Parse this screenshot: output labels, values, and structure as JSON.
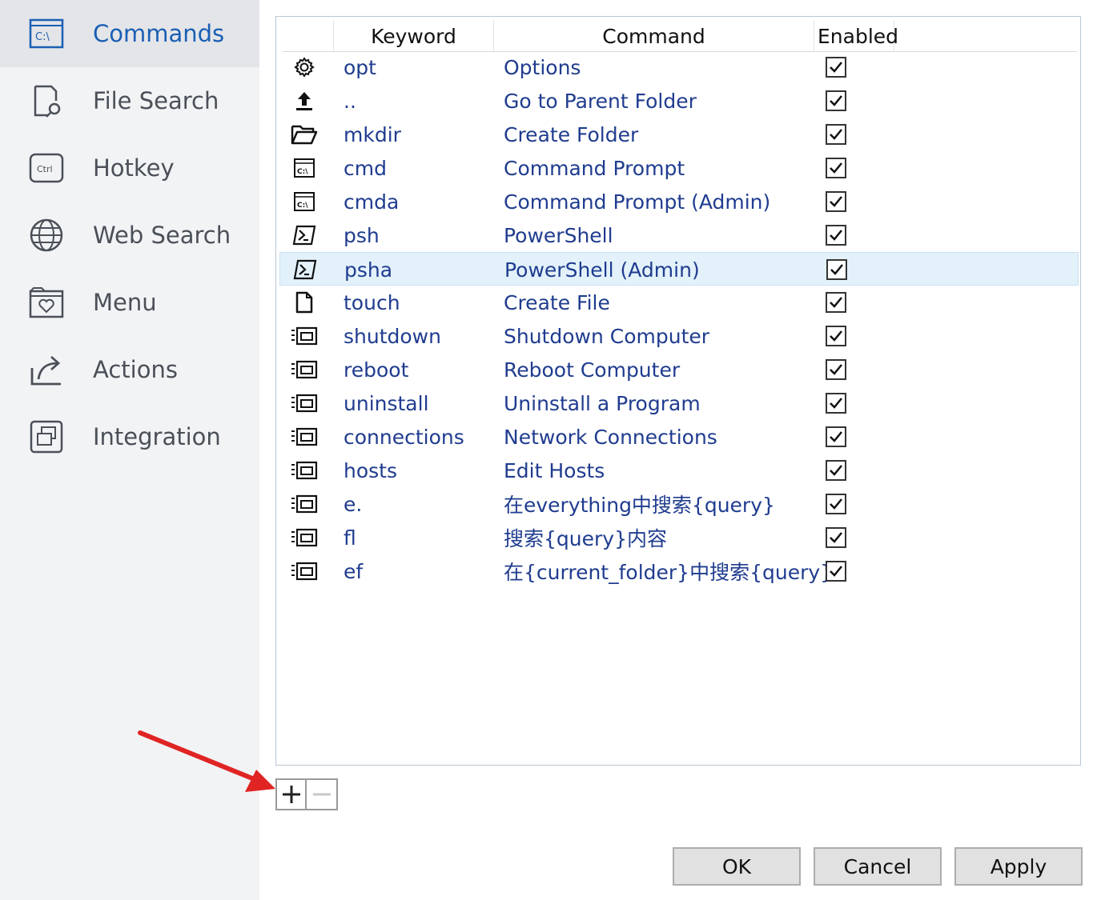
{
  "sidebar": {
    "items": [
      {
        "label": "Commands",
        "icon": "cmd-window-icon",
        "active": true
      },
      {
        "label": "File Search",
        "icon": "file-search-icon"
      },
      {
        "label": "Hotkey",
        "icon": "ctrl-key-icon"
      },
      {
        "label": "Web Search",
        "icon": "globe-icon"
      },
      {
        "label": "Menu",
        "icon": "menu-heart-icon"
      },
      {
        "label": "Actions",
        "icon": "share-arrow-icon"
      },
      {
        "label": "Integration",
        "icon": "integration-icon"
      }
    ],
    "cmd_icon_text": "C:\\",
    "ctrl_icon_text": "Ctrl"
  },
  "table": {
    "headers": {
      "keyword": "Keyword",
      "command": "Command",
      "enabled": "Enabled"
    },
    "rows": [
      {
        "icon": "gear-icon",
        "keyword": "opt",
        "command": "Options",
        "enabled": true
      },
      {
        "icon": "upload-arrow-icon",
        "keyword": "..",
        "command": "Go to Parent Folder",
        "enabled": true
      },
      {
        "icon": "folder-open-icon",
        "keyword": "mkdir",
        "command": "Create Folder",
        "enabled": true
      },
      {
        "icon": "cmd-prompt-icon",
        "keyword": "cmd",
        "command": "Command Prompt",
        "enabled": true
      },
      {
        "icon": "cmd-prompt-icon",
        "keyword": "cmda",
        "command": "Command Prompt (Admin)",
        "enabled": true
      },
      {
        "icon": "powershell-icon",
        "keyword": "psh",
        "command": "PowerShell",
        "enabled": true
      },
      {
        "icon": "powershell-icon",
        "keyword": "psha",
        "command": "PowerShell (Admin)",
        "enabled": true,
        "selected": true
      },
      {
        "icon": "file-icon",
        "keyword": "touch",
        "command": "Create File",
        "enabled": true
      },
      {
        "icon": "list-window-icon",
        "keyword": "shutdown",
        "command": "Shutdown Computer",
        "enabled": true
      },
      {
        "icon": "list-window-icon",
        "keyword": "reboot",
        "command": "Reboot Computer",
        "enabled": true
      },
      {
        "icon": "list-window-icon",
        "keyword": "uninstall",
        "command": "Uninstall a Program",
        "enabled": true
      },
      {
        "icon": "list-window-icon",
        "keyword": "connections",
        "command": "Network Connections",
        "enabled": true
      },
      {
        "icon": "list-window-icon",
        "keyword": "hosts",
        "command": "Edit Hosts",
        "enabled": true
      },
      {
        "icon": "list-window-icon",
        "keyword": "e.",
        "command": "在everything中搜索{query}",
        "enabled": true
      },
      {
        "icon": "list-window-icon",
        "keyword": "fl",
        "command": "搜索{query}内容",
        "enabled": true
      },
      {
        "icon": "list-window-icon",
        "keyword": "ef",
        "command": "在{current_folder}中搜索{query}",
        "enabled": true
      }
    ]
  },
  "toolbar": {
    "add_label": "+",
    "remove_label": "−"
  },
  "buttons": {
    "ok": "OK",
    "cancel": "Cancel",
    "apply": "Apply"
  },
  "colors": {
    "accent": "#1a5fb4",
    "link_text": "#1f3c8f",
    "selection": "#e3f1fb",
    "arrow": "#e02424"
  }
}
